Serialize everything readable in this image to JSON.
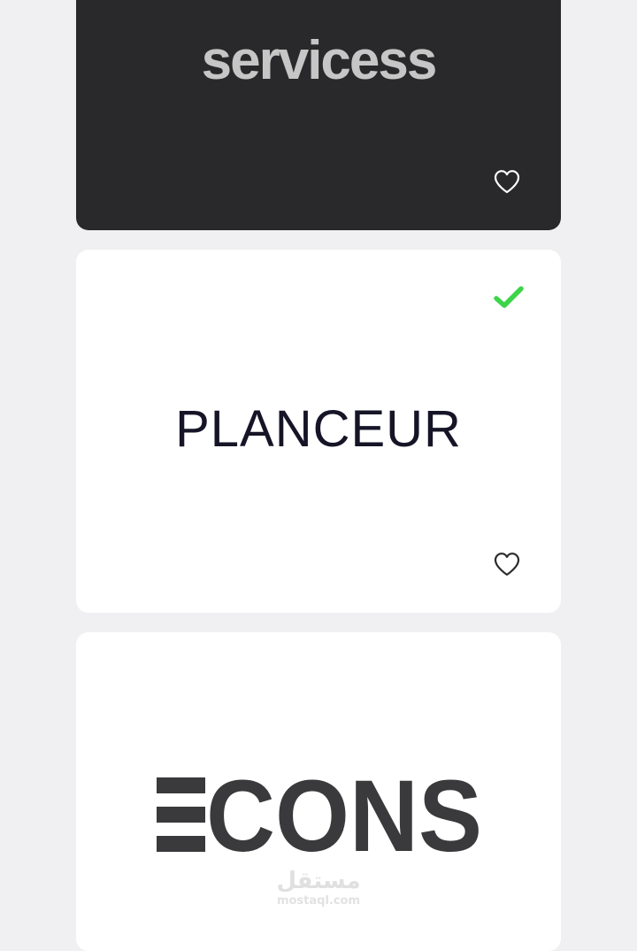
{
  "cards": [
    {
      "logo_text": "servicess",
      "background": "#29292b",
      "logo_color": "#c6c6c6",
      "favorite_icon": "heart-outline-icon",
      "selected": false
    },
    {
      "logo_text": "PLANCEUR",
      "background": "#ffffff",
      "logo_color": "#161527",
      "favorite_icon": "heart-outline-icon",
      "selected": true,
      "selected_icon": "checkmark-icon",
      "selected_color": "#3ed44a"
    },
    {
      "logo_text": "ECONS",
      "background": "#ffffff",
      "logo_color": "#3a3a3c",
      "selected": false
    }
  ],
  "watermark": {
    "arabic": "مستقل",
    "latin": "mostaql.com"
  },
  "page_background": "#f0f0f2"
}
